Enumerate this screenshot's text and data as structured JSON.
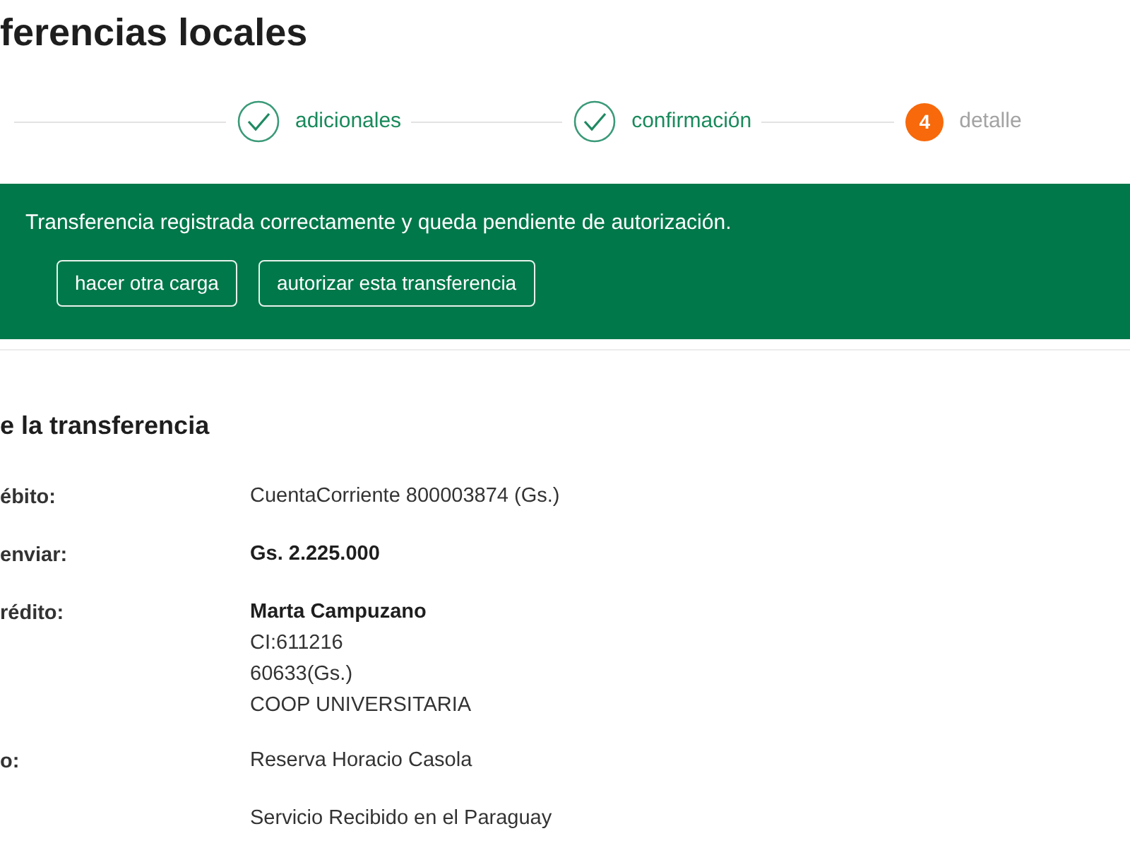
{
  "page": {
    "title": "ferencias locales"
  },
  "steps": [
    {
      "label": "adicionales",
      "completed": true
    },
    {
      "label": "confirmación",
      "completed": true
    },
    {
      "number": "4",
      "label": "detalle",
      "completed": false
    }
  ],
  "banner": {
    "message": "Transferencia registrada correctamente y queda pendiente de autorización.",
    "buttons": [
      "hacer otra carga",
      "autorizar esta transferencia"
    ]
  },
  "section": {
    "title": "e la transferencia",
    "rows": [
      {
        "label": "ébito:",
        "lines": [
          {
            "text": "CuentaCorriente 800003874 (Gs.)",
            "bold": false
          }
        ]
      },
      {
        "label": "enviar:",
        "lines": [
          {
            "text": "Gs. 2.225.000",
            "bold": true
          }
        ]
      },
      {
        "label": "rédito:",
        "lines": [
          {
            "text": "Marta Campuzano",
            "bold": true
          },
          {
            "text": "CI:611216",
            "bold": false
          },
          {
            "text": "60633(Gs.)",
            "bold": false
          },
          {
            "text": "COOP UNIVERSITARIA",
            "bold": false
          }
        ]
      },
      {
        "label": "o:",
        "lines": [
          {
            "text": "Reserva Horacio Casola",
            "bold": false
          }
        ]
      },
      {
        "lines": [
          {
            "text": "Servicio Recibido en el Paraguay",
            "bold": false
          }
        ]
      }
    ]
  }
}
